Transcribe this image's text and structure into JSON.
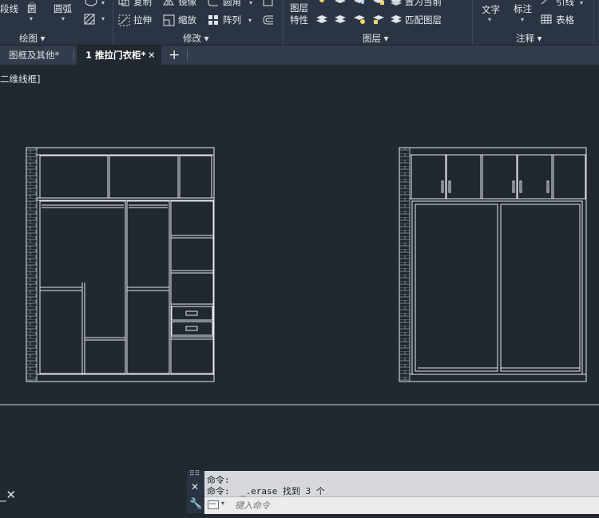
{
  "ribbon": {
    "draw_panel": {
      "title": "绘图",
      "polyline": "段线",
      "circle": "圆",
      "arc": "圆弧"
    },
    "modify_panel": {
      "title": "修改",
      "copy": "复制",
      "mirror": "镜像",
      "fillet": "圆角",
      "stretch": "拉伸",
      "scale": "缩放",
      "array": "阵列"
    },
    "layers_panel": {
      "title": "图层",
      "layer_props_line1": "图层",
      "layer_props_line2": "特性",
      "make_current": "置为当前",
      "match_layer": "匹配图层"
    },
    "annotation_panel": {
      "title": "注释",
      "text": "文字",
      "dimension": "标注",
      "leader": "引线",
      "table": "表格"
    }
  },
  "tabs": [
    {
      "label": "图框及其他*"
    },
    {
      "label": "1 推拉门衣柜*"
    }
  ],
  "viewport_label": "二维线框]",
  "command": {
    "history": [
      "命令:",
      "命令:  _.erase 找到 3 个"
    ],
    "placeholder": "键入命令"
  },
  "colors": {
    "canvas": "#212830",
    "ribbon": "#2b3442",
    "line": "#e6e9ee",
    "hatch": "#9ea4ac"
  }
}
